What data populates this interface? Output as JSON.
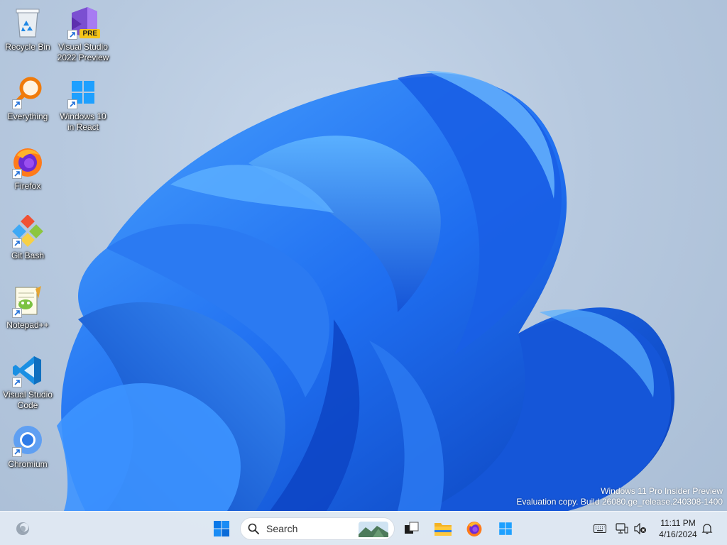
{
  "desktop": {
    "icons": [
      {
        "label": "Recycle Bin"
      },
      {
        "label": "Visual Studio\n2022 Preview",
        "badge": "PRE"
      },
      {
        "label": "Everything"
      },
      {
        "label": "Windows 10\nin React"
      },
      {
        "label": "Firefox"
      },
      {
        "label": "Git Bash"
      },
      {
        "label": "Notepad++"
      },
      {
        "label": "Visual Studio\nCode"
      },
      {
        "label": "Chromium"
      }
    ],
    "watermark": {
      "line1": "Windows 11 Pro Insider Preview",
      "line2": "Evaluation copy. Build 26080.ge_release.240308-1400"
    }
  },
  "taskbar": {
    "search": {
      "placeholder": "Search"
    },
    "apps": [
      "start-icon",
      "task-view-icon",
      "file-explorer-icon",
      "firefox-icon",
      "windows-10-react-icon"
    ],
    "clock": {
      "time": "11:11 PM",
      "date": "4/16/2024"
    },
    "tray": [
      "keyboard-icon",
      "network-icon",
      "volume-muted-icon",
      "notification-bell-icon"
    ]
  },
  "colors": {
    "accent": "#0a5fd8",
    "wallpaper_bg": "#b7c9df",
    "taskbar_bg": "#e2eaf4"
  }
}
